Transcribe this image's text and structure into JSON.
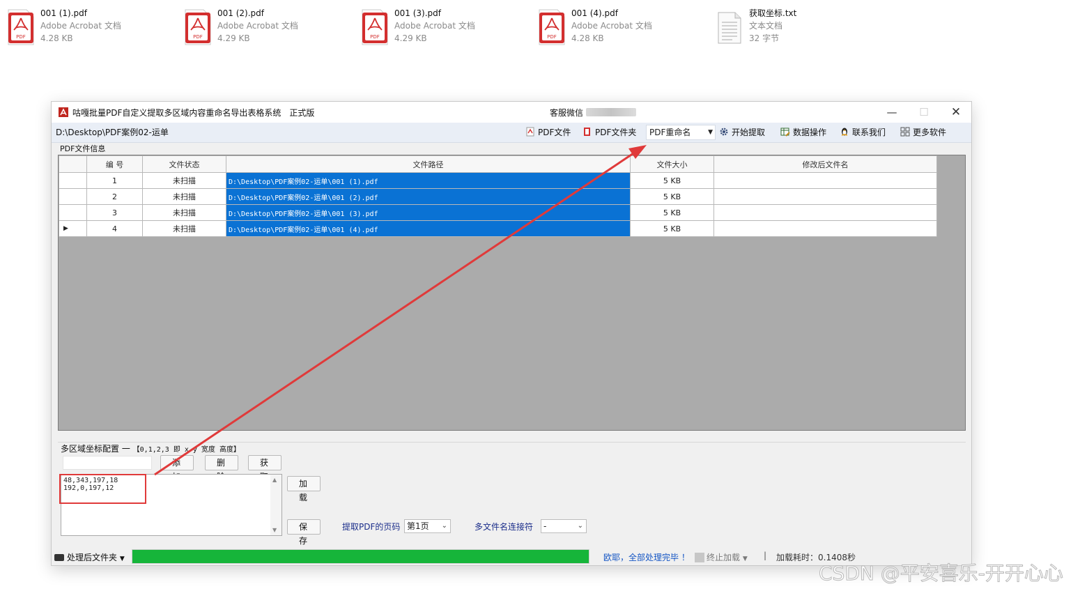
{
  "desktop_files": [
    {
      "name": "001 (1).pdf",
      "type": "Adobe Acrobat 文档",
      "size": "4.28 KB",
      "icon": "pdf-icon"
    },
    {
      "name": "001 (2).pdf",
      "type": "Adobe Acrobat 文档",
      "size": "4.29 KB",
      "icon": "pdf-icon"
    },
    {
      "name": "001 (3).pdf",
      "type": "Adobe Acrobat 文档",
      "size": "4.29 KB",
      "icon": "pdf-icon"
    },
    {
      "name": "001 (4).pdf",
      "type": "Adobe Acrobat 文档",
      "size": "4.28 KB",
      "icon": "pdf-icon"
    },
    {
      "name": "获取坐标.txt",
      "type": "文本文档",
      "size": "32 字节",
      "icon": "txt-file-icon"
    }
  ],
  "pdf_badge": "PDF",
  "window": {
    "title": "咕嘎批量PDF自定义提取多区域内容重命名导出表格系统",
    "edition": "正式版",
    "support_label": "客服微信",
    "minimize_symbol": "—",
    "maximize_symbol": "☐",
    "close_symbol": "✕"
  },
  "toolbar": {
    "path": "D:\\Desktop\\PDF案例02-运单",
    "pdf_file": "PDF文件",
    "pdf_folder": "PDF文件夹",
    "mode_select": "PDF重命名",
    "start": "开始提取",
    "data_ops": "数据操作",
    "contact": "联系我们",
    "more": "更多软件"
  },
  "grid": {
    "group_label": "PDF文件信息",
    "columns": [
      "编 号",
      "文件状态",
      "文件路径",
      "文件大小",
      "修改后文件名"
    ],
    "rows": [
      {
        "no": "1",
        "status": "未扫描",
        "path": "D:\\Desktop\\PDF案例02-运单\\001 (1).pdf",
        "size": "5 KB",
        "new_name": "",
        "current": false
      },
      {
        "no": "2",
        "status": "未扫描",
        "path": "D:\\Desktop\\PDF案例02-运单\\001 (2).pdf",
        "size": "5 KB",
        "new_name": "",
        "current": false
      },
      {
        "no": "3",
        "status": "未扫描",
        "path": "D:\\Desktop\\PDF案例02-运单\\001 (3).pdf",
        "size": "5 KB",
        "new_name": "",
        "current": false
      },
      {
        "no": "4",
        "status": "未扫描",
        "path": "D:\\Desktop\\PDF案例02-运单\\001 (4).pdf",
        "size": "5 KB",
        "new_name": "",
        "current": true
      }
    ]
  },
  "config": {
    "title": "多区域坐标配置 一",
    "hint": "【0,1,2,3 即 x y 宽度 高度】",
    "add_button": "添 加",
    "delete_button": "删 除",
    "get_button": "获 取",
    "load_button": "加 载",
    "save_button": "保 存",
    "coordinates": [
      "48,343,197,18",
      "192,0,197,12"
    ],
    "page_label": "提取PDF的页码",
    "page_value": "第1页",
    "joiner_label": "多文件名连接符",
    "joiner_value": "-"
  },
  "status": {
    "folder_label": "处理后文件夹",
    "progress": 1.0,
    "message": "欧耶，全部处理完毕 ！",
    "stop_label": "终止加载",
    "separator": "|",
    "timing": "加载耗时：0.1408秒"
  },
  "watermark": "CSDN @平安喜乐-开开心心",
  "colors": {
    "selection_blue": "#0a72d4",
    "progress_green": "#16b53a",
    "annotation_red": "#e03a3a",
    "status_blue": "#1556c4"
  }
}
